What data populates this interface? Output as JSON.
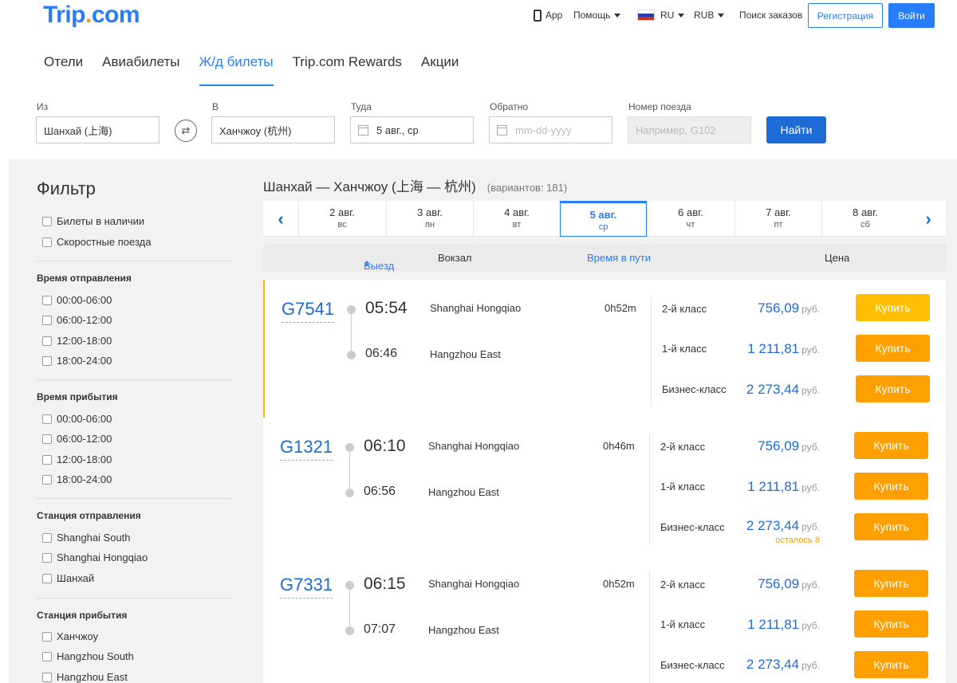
{
  "header": {
    "logo_main": "Trip",
    "logo_dot": ".",
    "logo_tail": "com",
    "app": "App",
    "help": "Помощь",
    "lang": "RU",
    "currency": "RUB",
    "orders": "Поиск заказов",
    "register": "Регистрация",
    "login": "Войти"
  },
  "nav": [
    "Отели",
    "Авиабилеты",
    "Ж/д билеты",
    "Trip.com Rewards",
    "Акции"
  ],
  "search": {
    "from_label": "Из",
    "from_value": "Шанхай (上海)",
    "to_label": "В",
    "to_value": "Ханчжоу (杭州)",
    "depart_label": "Туда",
    "depart_value": "5 авг., ср",
    "return_label": "Обратно",
    "return_placeholder": "mm-dd-yyyy",
    "train_label": "Номер поезда",
    "train_placeholder": "Например, G102",
    "button": "Найти"
  },
  "filter": {
    "title": "Фильтр",
    "top": [
      "Билеты в наличии",
      "Скоростные поезда"
    ],
    "dep_time_title": "Время отправления",
    "dep_times": [
      "00:00-06:00",
      "06:00-12:00",
      "12:00-18:00",
      "18:00-24:00"
    ],
    "arr_time_title": "Время прибытия",
    "arr_times": [
      "00:00-06:00",
      "06:00-12:00",
      "12:00-18:00",
      "18:00-24:00"
    ],
    "dep_station_title": "Станция отправления",
    "dep_stations": [
      "Shanghai South",
      "Shanghai Hongqiao",
      "Шанхай"
    ],
    "arr_station_title": "Станция прибытия",
    "arr_stations": [
      "Ханчжоу",
      "Hangzhou South",
      "Hangzhou East"
    ]
  },
  "results": {
    "route": "Шанхай — Ханчжоу (上海 — 杭州)",
    "count": "(вариантов: 181)",
    "dates": [
      {
        "d": "2 авг.",
        "w": "вс"
      },
      {
        "d": "3 авг.",
        "w": "пн"
      },
      {
        "d": "4 авг.",
        "w": "вт"
      },
      {
        "d": "5 авг.",
        "w": "ср"
      },
      {
        "d": "6 авг.",
        "w": "чт"
      },
      {
        "d": "7 авг.",
        "w": "пт"
      },
      {
        "d": "8 авг.",
        "w": "сб"
      }
    ],
    "head_depart": "Выезд",
    "head_station": "Вокзал",
    "head_duration": "Время в пути",
    "head_price": "Цена",
    "currency": "руб.",
    "buy": "Купить",
    "trains": [
      {
        "code": "G7541",
        "dep": "05:54",
        "arr": "06:46",
        "dep_station": "Shanghai Hongqiao",
        "arr_station": "Hangzhou East",
        "duration": "0h52m",
        "classes": [
          {
            "name": "2-й класс",
            "price": "756,09"
          },
          {
            "name": "1-й класс",
            "price": "1 211,81"
          },
          {
            "name": "Бизнес-класс",
            "price": "2 273,44"
          }
        ]
      },
      {
        "code": "G1321",
        "dep": "06:10",
        "arr": "06:56",
        "dep_station": "Shanghai Hongqiao",
        "arr_station": "Hangzhou East",
        "duration": "0h46m",
        "classes": [
          {
            "name": "2-й класс",
            "price": "756,09"
          },
          {
            "name": "1-й класс",
            "price": "1 211,81"
          },
          {
            "name": "Бизнес-класс",
            "price": "2 273,44",
            "note": "осталось 8"
          }
        ]
      },
      {
        "code": "G7331",
        "dep": "06:15",
        "arr": "07:07",
        "dep_station": "Shanghai Hongqiao",
        "arr_station": "Hangzhou East",
        "duration": "0h52m",
        "classes": [
          {
            "name": "2-й класс",
            "price": "756,09"
          },
          {
            "name": "1-й класс",
            "price": "1 211,81"
          },
          {
            "name": "Бизнес-класс",
            "price": "2 273,44"
          }
        ]
      }
    ]
  }
}
